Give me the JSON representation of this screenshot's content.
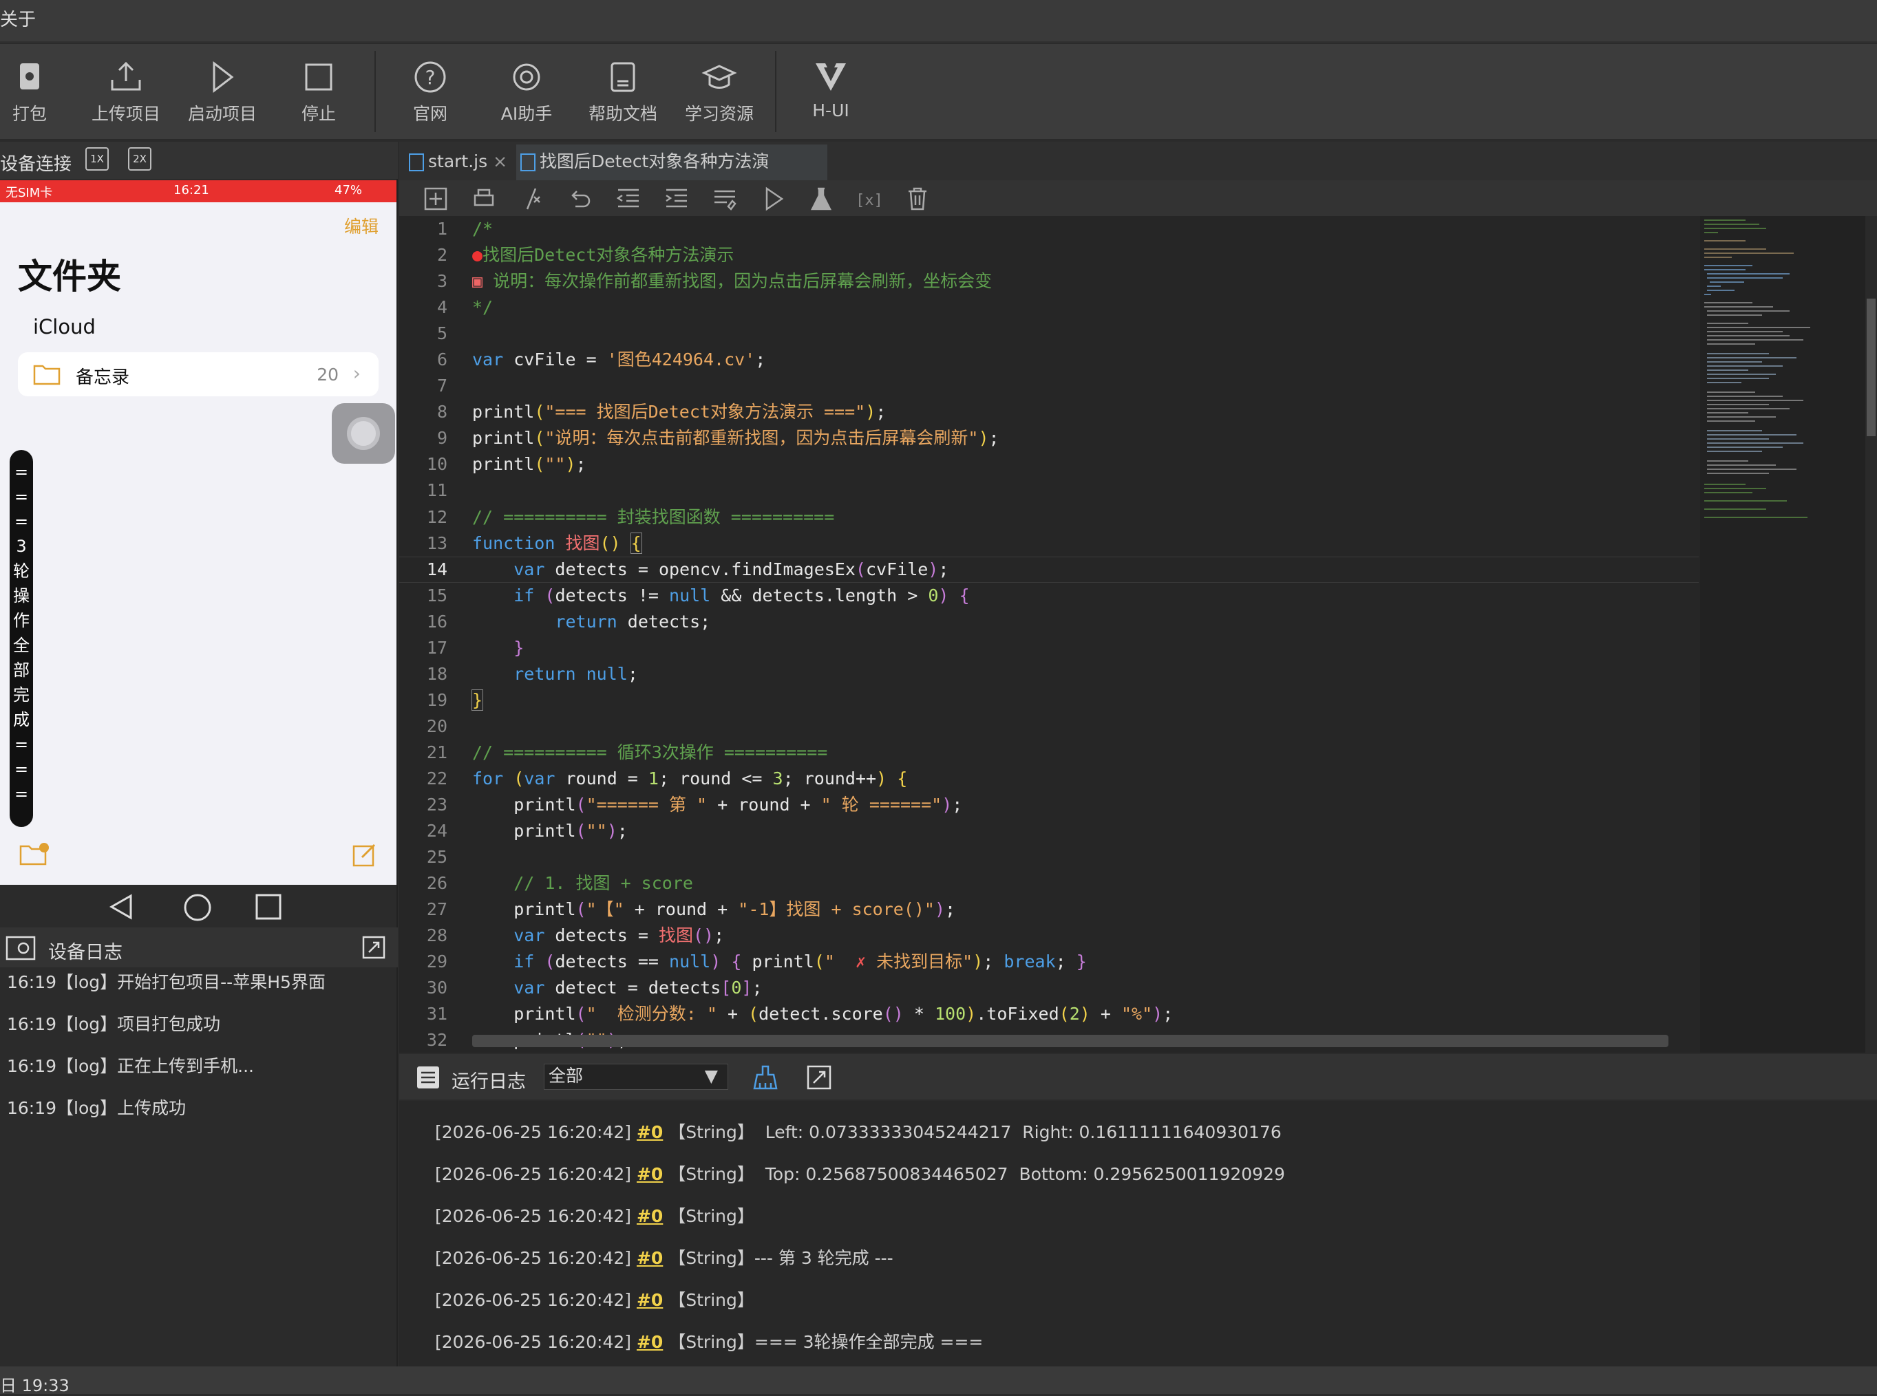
{
  "menu": {
    "item": "关于"
  },
  "toolbar": {
    "pack": "打包",
    "upload": "上传项目",
    "start": "启动项目",
    "stop": "停止",
    "site": "官网",
    "ai": "AI助手",
    "docs": "帮助文档",
    "learn": "学习资源",
    "hui": "H-UI"
  },
  "device": {
    "title": "设备连接",
    "zoom1": "1X",
    "zoom2": "2X"
  },
  "phone": {
    "status_left": "无SIM卡",
    "status_time": "16:21",
    "status_right": "47%",
    "edit": "编辑",
    "title": "文件夹",
    "icloud": "iCloud",
    "folder": "备忘录",
    "folder_count": "20",
    "banner": "===3轮操作全部完成==="
  },
  "device_log": {
    "title": "设备日志",
    "entries": [
      "16:19【log】开始打包项目--苹果H5界面",
      "16:19【log】项目打包成功",
      "16:19【log】正在上传到手机...",
      "16:19【log】上传成功"
    ]
  },
  "tabs": [
    {
      "label": "start.js"
    },
    {
      "label": "找图后Detect对象各种方法演示.js"
    }
  ],
  "editor": {
    "active_line": 14,
    "lines": [
      "1",
      "2",
      "3",
      "4",
      "5",
      "6",
      "7",
      "8",
      "9",
      "10",
      "11",
      "12",
      "13",
      "14",
      "15",
      "16",
      "17",
      "18",
      "19",
      "20",
      "21",
      "22",
      "23",
      "24",
      "25",
      "26",
      "27",
      "28",
      "29",
      "30",
      "31",
      "32"
    ]
  },
  "run_log": {
    "title": "运行日志",
    "filter": "全部",
    "entries": [
      "[2026-06-25 16:20:42]",
      "#0",
      "【String】  Left: 0.07333333045244217  Right: 0.16111111640930176",
      "[2026-06-25 16:20:42]",
      "#0",
      "【String】  Top: 0.25687500834465027  Bottom: 0.2956250011920929",
      "[2026-06-25 16:20:42]",
      "#0",
      "【String】",
      "[2026-06-25 16:20:42]",
      "#0",
      "【String】--- 第 3 轮完成 ---",
      "[2026-06-25 16:20:42]",
      "#0",
      "【String】",
      "[2026-06-25 16:20:42]",
      "#0",
      "【String】=== 3轮操作全部完成 ==="
    ]
  },
  "footer": {
    "text": "日 19:33"
  }
}
